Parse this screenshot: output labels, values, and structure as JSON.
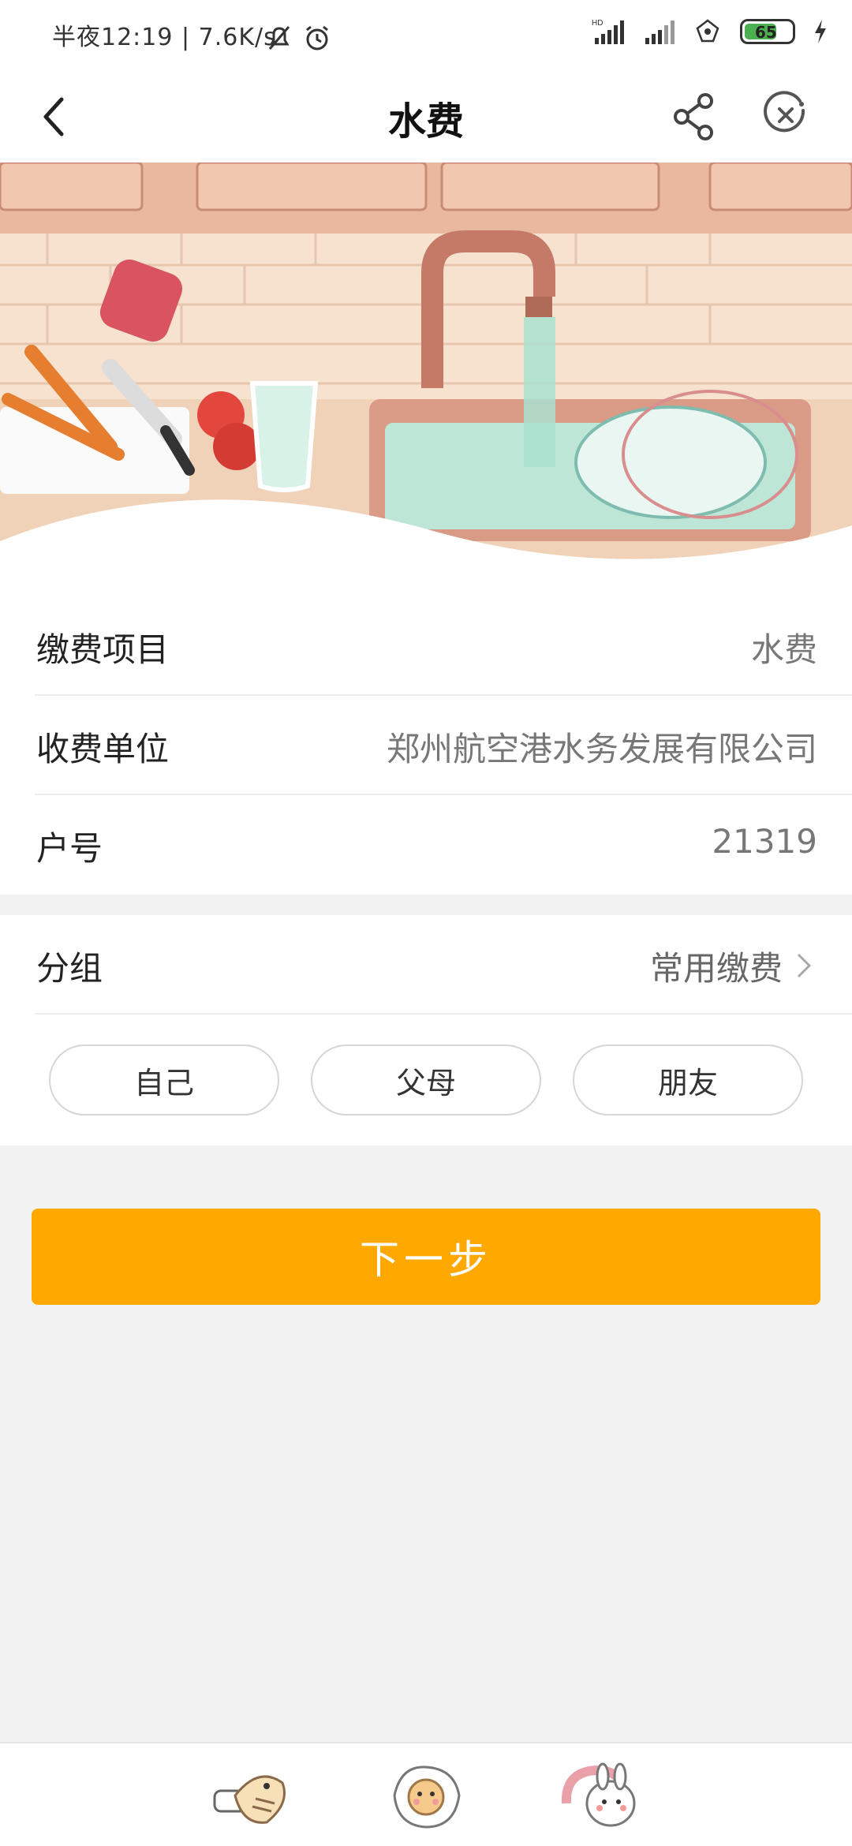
{
  "status_bar": {
    "time_text": "半夜12:19 | 7.6K/s",
    "battery": "65"
  },
  "nav": {
    "title": "水费"
  },
  "info": {
    "rows": [
      {
        "label": "缴费项目",
        "value": "水费"
      },
      {
        "label": "收费单位",
        "value": "郑州航空港水务发展有限公司"
      },
      {
        "label": "户号",
        "value": "21319"
      }
    ]
  },
  "group": {
    "label": "分组",
    "value": "常用缴费",
    "chips": [
      "自己",
      "父母",
      "朋友"
    ]
  },
  "next_button": "下一步",
  "colors": {
    "accent": "#ffa800"
  }
}
